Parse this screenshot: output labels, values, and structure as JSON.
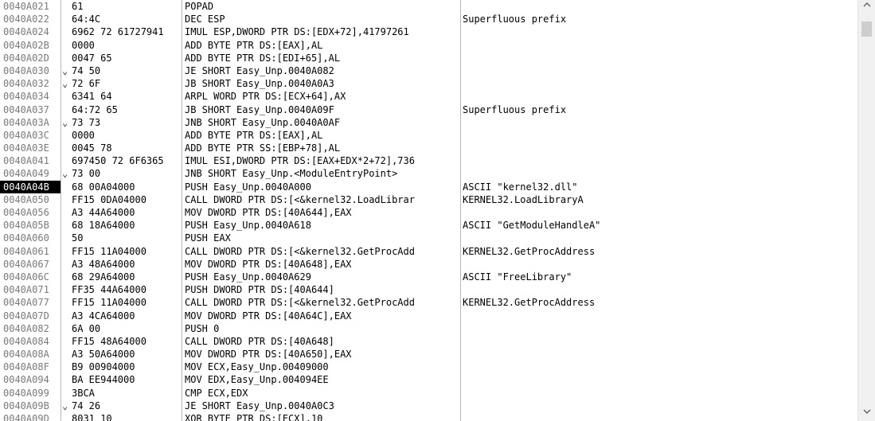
{
  "rows": [
    {
      "addr": "0040A021",
      "jump": "",
      "hex": "61",
      "dis": "POPAD",
      "cmt": ""
    },
    {
      "addr": "0040A022",
      "jump": "",
      "hex": "64:4C",
      "dis": "DEC ESP",
      "cmt": "Superfluous prefix"
    },
    {
      "addr": "0040A024",
      "jump": "",
      "hex": "6962 72 61727941",
      "dis": "IMUL ESP,DWORD PTR DS:[EDX+72],41797261",
      "cmt": ""
    },
    {
      "addr": "0040A02B",
      "jump": "",
      "hex": "0000",
      "dis": "ADD BYTE PTR DS:[EAX],AL",
      "cmt": ""
    },
    {
      "addr": "0040A02D",
      "jump": "",
      "hex": "0047 65",
      "dis": "ADD BYTE PTR DS:[EDI+65],AL",
      "cmt": ""
    },
    {
      "addr": "0040A030",
      "jump": "⌄",
      "hex": "74 50",
      "dis": "JE SHORT Easy_Unp.0040A082",
      "cmt": ""
    },
    {
      "addr": "0040A032",
      "jump": "⌄",
      "hex": "72 6F",
      "dis": "JB SHORT Easy_Unp.0040A0A3",
      "cmt": ""
    },
    {
      "addr": "0040A034",
      "jump": "",
      "hex": "6341 64",
      "dis": "ARPL WORD PTR DS:[ECX+64],AX",
      "cmt": ""
    },
    {
      "addr": "0040A037",
      "jump": "",
      "hex": "64:72 65",
      "dis": "JB SHORT Easy_Unp.0040A09F",
      "cmt": "Superfluous prefix"
    },
    {
      "addr": "0040A03A",
      "jump": "⌄",
      "hex": "73 73",
      "dis": "JNB SHORT Easy_Unp.0040A0AF",
      "cmt": ""
    },
    {
      "addr": "0040A03C",
      "jump": "",
      "hex": "0000",
      "dis": "ADD BYTE PTR DS:[EAX],AL",
      "cmt": ""
    },
    {
      "addr": "0040A03E",
      "jump": "",
      "hex": "0045 78",
      "dis": "ADD BYTE PTR SS:[EBP+78],AL",
      "cmt": ""
    },
    {
      "addr": "0040A041",
      "jump": "",
      "hex": "697450 72 6F6365",
      "dis": "IMUL ESI,DWORD PTR DS:[EAX+EDX*2+72],736",
      "cmt": ""
    },
    {
      "addr": "0040A049",
      "jump": "⌄",
      "hex": "73 00",
      "dis": "JNB SHORT Easy_Unp.<ModuleEntryPoint>",
      "cmt": ""
    },
    {
      "addr": "0040A04B",
      "jump": "",
      "hex": "68 00A04000",
      "dis": "PUSH Easy_Unp.0040A000",
      "cmt": "ASCII \"kernel32.dll\"",
      "selected": true
    },
    {
      "addr": "0040A050",
      "jump": "",
      "hex": "FF15 0DA04000",
      "dis": "CALL DWORD PTR DS:[<&kernel32.LoadLibrar",
      "cmt": "KERNEL32.LoadLibraryA"
    },
    {
      "addr": "0040A056",
      "jump": "",
      "hex": "A3 44A64000",
      "dis": "MOV DWORD PTR DS:[40A644],EAX",
      "cmt": ""
    },
    {
      "addr": "0040A05B",
      "jump": "",
      "hex": "68 18A64000",
      "dis": "PUSH Easy_Unp.0040A618",
      "cmt": "ASCII \"GetModuleHandleA\""
    },
    {
      "addr": "0040A060",
      "jump": "",
      "hex": "50",
      "dis": "PUSH EAX",
      "cmt": ""
    },
    {
      "addr": "0040A061",
      "jump": "",
      "hex": "FF15 11A04000",
      "dis": "CALL DWORD PTR DS:[<&kernel32.GetProcAdd",
      "cmt": "KERNEL32.GetProcAddress"
    },
    {
      "addr": "0040A067",
      "jump": "",
      "hex": "A3 48A64000",
      "dis": "MOV DWORD PTR DS:[40A648],EAX",
      "cmt": ""
    },
    {
      "addr": "0040A06C",
      "jump": "",
      "hex": "68 29A64000",
      "dis": "PUSH Easy_Unp.0040A629",
      "cmt": "ASCII \"FreeLibrary\""
    },
    {
      "addr": "0040A071",
      "jump": "",
      "hex": "FF35 44A64000",
      "dis": "PUSH DWORD PTR DS:[40A644]",
      "cmt": ""
    },
    {
      "addr": "0040A077",
      "jump": "",
      "hex": "FF15 11A04000",
      "dis": "CALL DWORD PTR DS:[<&kernel32.GetProcAdd",
      "cmt": "KERNEL32.GetProcAddress"
    },
    {
      "addr": "0040A07D",
      "jump": "",
      "hex": "A3 4CA64000",
      "dis": "MOV DWORD PTR DS:[40A64C],EAX",
      "cmt": ""
    },
    {
      "addr": "0040A082",
      "jump": "",
      "hex": "6A 00",
      "dis": "PUSH 0",
      "cmt": ""
    },
    {
      "addr": "0040A084",
      "jump": "",
      "hex": "FF15 48A64000",
      "dis": "CALL DWORD PTR DS:[40A648]",
      "cmt": ""
    },
    {
      "addr": "0040A08A",
      "jump": "",
      "hex": "A3 50A64000",
      "dis": "MOV DWORD PTR DS:[40A650],EAX",
      "cmt": ""
    },
    {
      "addr": "0040A08F",
      "jump": "",
      "hex": "B9 00904000",
      "dis": "MOV ECX,Easy_Unp.00409000",
      "cmt": ""
    },
    {
      "addr": "0040A094",
      "jump": "",
      "hex": "BA EE944000",
      "dis": "MOV EDX,Easy_Unp.004094EE",
      "cmt": ""
    },
    {
      "addr": "0040A099",
      "jump": "",
      "hex": "3BCA",
      "dis": "CMP ECX,EDX",
      "cmt": ""
    },
    {
      "addr": "0040A09B",
      "jump": "⌄",
      "hex": "74 26",
      "dis": "JE SHORT Easy_Unp.0040A0C3",
      "cmt": ""
    },
    {
      "addr": "0040A09D",
      "jump": "",
      "hex": "8031 10",
      "dis": "XOR BYTE PTR DS:[ECX],10",
      "cmt": ""
    }
  ],
  "scrollbar": {
    "up_icon": "▲",
    "down_icon": "▼",
    "up_name": "scroll-up-arrow-icon",
    "down_name": "scroll-down-arrow-icon"
  }
}
